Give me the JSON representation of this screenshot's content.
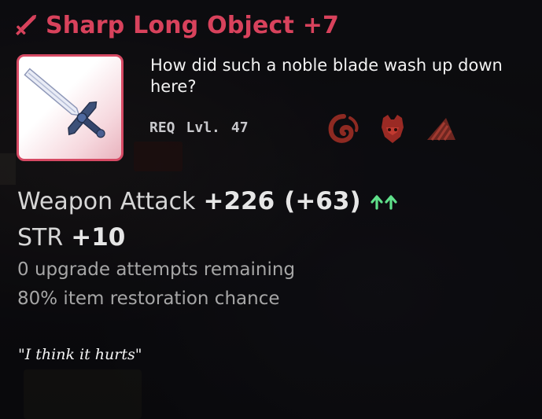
{
  "item": {
    "name": "Sharp Long Object +7",
    "description": "How did such a noble blade wash up down here?",
    "requirement": {
      "prefix": "REQ",
      "level_label": "Lvl.",
      "level": "47"
    },
    "class_icons": [
      "pirate-swirl-icon",
      "warrior-helmet-icon",
      "thief-claw-icon"
    ],
    "stats": {
      "weapon_attack": {
        "label": "Weapon Attack",
        "value": "+226",
        "bonus": "(+63)",
        "indicator": "double-up-arrow-icon"
      },
      "str": {
        "label": "STR",
        "value": "+10"
      }
    },
    "upgrade_text": "0 upgrade attempts remaining",
    "restoration_text": "80% item restoration chance",
    "flavor_text": "\"I think it hurts\""
  },
  "colors": {
    "title": "#d8425c",
    "frame": "#d64a64",
    "upgrade_arrows": "#5fe08a",
    "stat_text": "#e6e6e6",
    "info_text": "#a6a6a6"
  }
}
